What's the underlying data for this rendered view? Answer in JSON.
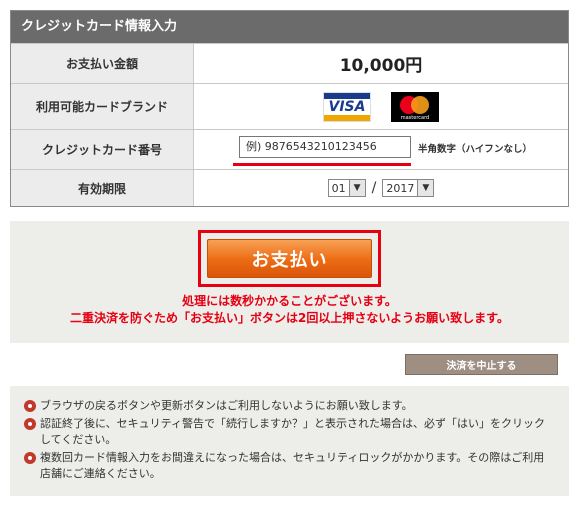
{
  "panel": {
    "title": "クレジットカード情報入力",
    "rows": {
      "amount": {
        "label": "お支払い金額",
        "value": "10,000円"
      },
      "brands": {
        "label": "利用可能カードブランド",
        "visa": "VISA",
        "mastercard": "mastercard"
      },
      "card_number": {
        "label": "クレジットカード番号",
        "placeholder": "例) 9876543210123456",
        "note": "半角数字（ハイフンなし）"
      },
      "expiry": {
        "label": "有効期限",
        "month": "01",
        "year": "2017",
        "separator": "/"
      }
    }
  },
  "payment": {
    "button_label": "お支払い",
    "warning_line1": "処理には数秒かかることがございます。",
    "warning_line2": "二重決済を防ぐため「お支払い」ボタンは2回以上押さないようお願い致します。"
  },
  "cancel_button": "決済を中止する",
  "notes": [
    "ブラウザの戻るボタンや更新ボタンはご利用しないようにお願い致します。",
    "認証終了後に、セキュリティ警告で「続行しますか？」と表示された場合は、必ず「はい」をクリックしてください。",
    "複数回カード情報入力をお間違えになった場合は、セキュリティロックがかかります。その際はご利用店舗にご連絡ください。"
  ],
  "colors": {
    "header": "#6b6b6b",
    "accent_red": "#e60012",
    "pay_orange": "#ec6b13",
    "cancel_brown": "#9e8f82"
  }
}
